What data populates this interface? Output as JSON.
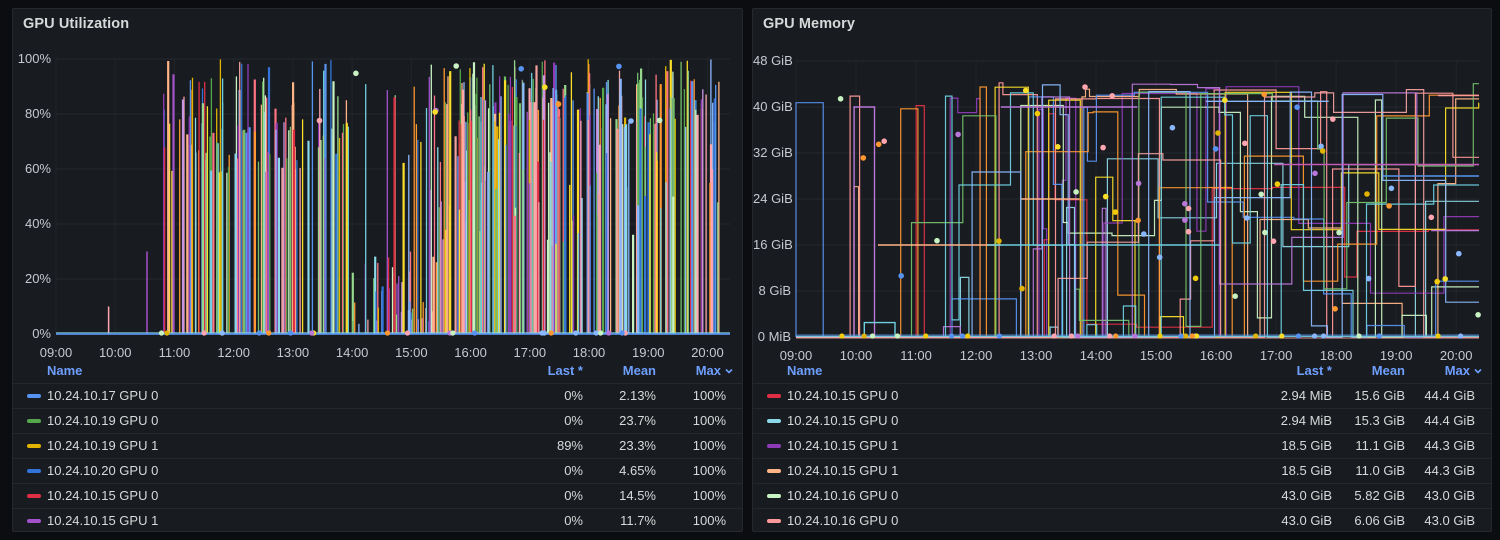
{
  "theme": {
    "page_bg": "#0c0d10",
    "panel_bg": "#181b1f",
    "panel_border": "#26282e",
    "text": "#d8d9da",
    "axis_text": "#c8c9d3",
    "link_blue": "#6e9fff",
    "grid": "rgba(204,204,220,0.07)"
  },
  "chart_data": [
    {
      "type": "line",
      "title": "GPU Utilization",
      "unit": "percent",
      "y_min": 0,
      "y_max": 100,
      "y_ticks": [
        "100%",
        "80%",
        "60%",
        "40%",
        "20%",
        "0%"
      ],
      "x_ticks": [
        "09:00",
        "10:00",
        "11:00",
        "12:00",
        "13:00",
        "14:00",
        "15:00",
        "16:00",
        "17:00",
        "18:00",
        "19:00",
        "20:00"
      ],
      "grid": true,
      "legend_position": "bottom-table",
      "legend": {
        "headers": {
          "name": "Name",
          "last": "Last *",
          "mean": "Mean",
          "max": "Max"
        },
        "sorted_by": "max",
        "rows": [
          {
            "color": "#5794F2",
            "name": "10.24.10.17 GPU 0",
            "last": "0%",
            "mean": "2.13%",
            "max": "100%"
          },
          {
            "color": "#56A64B",
            "name": "10.24.10.19 GPU 0",
            "last": "0%",
            "mean": "23.7%",
            "max": "100%"
          },
          {
            "color": "#E0B400",
            "name": "10.24.10.19 GPU 1",
            "last": "89%",
            "mean": "23.3%",
            "max": "100%"
          },
          {
            "color": "#3274D9",
            "name": "10.24.10.20 GPU 0",
            "last": "0%",
            "mean": "4.65%",
            "max": "100%"
          },
          {
            "color": "#E02F44",
            "name": "10.24.10.15 GPU 0",
            "last": "0%",
            "mean": "14.5%",
            "max": "100%"
          },
          {
            "color": "#A352CC",
            "name": "10.24.10.15 GPU 1",
            "last": "0%",
            "mean": "11.7%",
            "max": "100%"
          }
        ]
      },
      "render": {
        "seed": 1337,
        "palette": [
          "#E02F44",
          "#FF7383",
          "#FFA6B0",
          "#F2A0A0",
          "#56A64B",
          "#73BF69",
          "#96D98D",
          "#C8F2C2",
          "#E0B400",
          "#FADE2A",
          "#FF9830",
          "#FFB488",
          "#3274D9",
          "#5794F2",
          "#8AB8FF",
          "#6ED0E0",
          "#8AD8E8",
          "#8F3BB8",
          "#A352CC",
          "#CA95E5"
        ],
        "fixed_spikes": [
          {
            "x": 0.078,
            "h": 10,
            "c": "#FFA6B0"
          },
          {
            "x": 0.135,
            "h": 30,
            "c": "#A352CC"
          }
        ],
        "spike_regions": [
          {
            "x0": 0.155,
            "x1": 0.44,
            "n": 120,
            "hMin": 58,
            "hMax": 100
          },
          {
            "x0": 0.44,
            "x1": 0.565,
            "n": 42,
            "hMin": 3,
            "hMax": 32
          },
          {
            "x0": 0.44,
            "x1": 0.565,
            "n": 12,
            "hMin": 55,
            "hMax": 100
          },
          {
            "x0": 0.555,
            "x1": 0.64,
            "n": 50,
            "hMin": 25,
            "hMax": 100
          },
          {
            "x0": 0.6,
            "x1": 0.985,
            "n": 190,
            "hMin": 75,
            "hMax": 100
          },
          {
            "x0": 0.62,
            "x1": 0.985,
            "n": 45,
            "hMin": 30,
            "hMax": 75
          }
        ],
        "baseline_dots": 24,
        "upper_dots": 11,
        "dot_palette": [
          "#8AB8FF",
          "#FFA6B0",
          "#FADE2A",
          "#C8F2C2",
          "#FF9830",
          "#5794F2",
          "#E0B400",
          "#B877D9"
        ]
      }
    },
    {
      "type": "line",
      "title": "GPU Memory",
      "unit": "bytes",
      "y_min": 0,
      "y_max": 48,
      "y_ticks": [
        "48 GiB",
        "40 GiB",
        "32 GiB",
        "24 GiB",
        "16 GiB",
        "8 GiB",
        "0 MiB"
      ],
      "x_ticks": [
        "09:00",
        "10:00",
        "11:00",
        "12:00",
        "13:00",
        "14:00",
        "15:00",
        "16:00",
        "17:00",
        "18:00",
        "19:00",
        "20:00"
      ],
      "grid": true,
      "legend_position": "bottom-table",
      "legend": {
        "headers": {
          "name": "Name",
          "last": "Last *",
          "mean": "Mean",
          "max": "Max"
        },
        "sorted_by": "max",
        "rows": [
          {
            "color": "#E02F44",
            "name": "10.24.10.15 GPU 0",
            "last": "2.94 MiB",
            "mean": "15.6 GiB",
            "max": "44.4 GiB"
          },
          {
            "color": "#8AD8E8",
            "name": "10.24.10.15 GPU 0",
            "last": "2.94 MiB",
            "mean": "15.3 GiB",
            "max": "44.4 GiB"
          },
          {
            "color": "#8F3BB8",
            "name": "10.24.10.15 GPU 1",
            "last": "18.5 GiB",
            "mean": "11.1 GiB",
            "max": "44.3 GiB"
          },
          {
            "color": "#FFB488",
            "name": "10.24.10.15 GPU 1",
            "last": "18.5 GiB",
            "mean": "11.0 GiB",
            "max": "44.3 GiB"
          },
          {
            "color": "#C8F2C2",
            "name": "10.24.10.16 GPU 0",
            "last": "43.0 GiB",
            "mean": "5.82 GiB",
            "max": "43.0 GiB"
          },
          {
            "color": "#FF9898",
            "name": "10.24.10.16 GPU 0",
            "last": "43.0 GiB",
            "mean": "6.06 GiB",
            "max": "43.0 GiB"
          }
        ]
      },
      "render": {
        "seed": 4242,
        "series_count": 14,
        "palette": [
          "#E02F44",
          "#8AD8E8",
          "#8F3BB8",
          "#FFB488",
          "#C8F2C2",
          "#FF9898",
          "#5794F2",
          "#FF9830",
          "#FADE2A",
          "#73BF69",
          "#B877D9",
          "#6ED0E0",
          "#8AB8FF",
          "#F2A0A0"
        ],
        "long_lines": [
          {
            "v": 40,
            "x0": 0.085,
            "x1": 0.115,
            "c": "#B877D9"
          },
          {
            "v": 16,
            "x0": 0.12,
            "x1": 0.3,
            "c": "#FFB488"
          },
          {
            "v": 2.5,
            "x0": 0.1,
            "x1": 0.145,
            "c": "#6ED0E0"
          },
          {
            "v": 40,
            "x0": 0.3,
            "x1": 0.5,
            "c": "#B877D9"
          },
          {
            "v": 16,
            "x0": 0.28,
            "x1": 0.62,
            "c": "#6ED0E0"
          },
          {
            "v": 24,
            "x0": 0.33,
            "x1": 0.415,
            "c": "#FFB488"
          },
          {
            "v": 41,
            "x0": 0.6,
            "x1": 0.78,
            "c": "#8AB8FF"
          },
          {
            "v": 30,
            "x0": 0.7,
            "x1": 1.0,
            "c": "#C45AB3"
          },
          {
            "v": 28,
            "x0": 0.86,
            "x1": 1.0,
            "c": "#5794F2"
          },
          {
            "v": 42,
            "x0": 0.94,
            "x1": 1.0,
            "c": "#FF9898"
          },
          {
            "v": 18.5,
            "x0": 0.93,
            "x1": 1.0,
            "c": "#B877D9"
          }
        ],
        "scatter_dots": 55,
        "baseline_dots": 30,
        "dot_palette": [
          "#8AB8FF",
          "#FFA6B0",
          "#FADE2A",
          "#C8F2C2",
          "#FF9830",
          "#5794F2",
          "#F2CC0C",
          "#E0B400",
          "#B877D9"
        ]
      }
    }
  ]
}
